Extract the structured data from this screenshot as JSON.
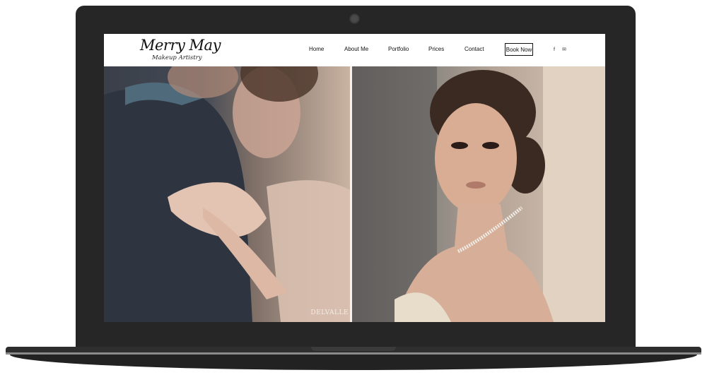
{
  "site": {
    "logo_main": "Merry May",
    "logo_sub": "Makeup Artistry"
  },
  "nav": {
    "items": [
      "Home",
      "About Me",
      "Portfolio",
      "Prices",
      "Contact"
    ],
    "book_label": "Book Now"
  },
  "social": {
    "facebook": "f",
    "email": "✉"
  },
  "hero": {
    "left_photo_alt": "Couple embracing, woman's hand with ring on man's shoulder",
    "right_photo_alt": "Woman leaning against wall with pearl necklace",
    "watermark": "DELVALLE"
  }
}
